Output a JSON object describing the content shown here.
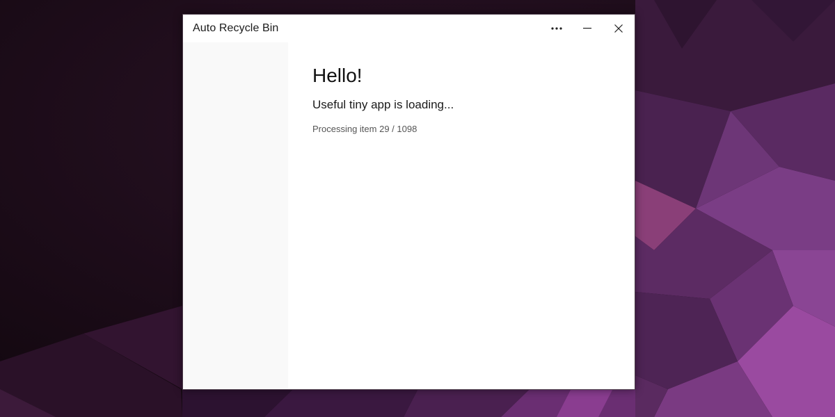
{
  "window": {
    "title": "Auto Recycle Bin",
    "controls": {
      "more_icon": "more-horizontal-icon",
      "minimize_icon": "minimize-icon",
      "close_icon": "close-icon"
    }
  },
  "main": {
    "heading": "Hello!",
    "subtitle": "Useful tiny app is loading...",
    "status": {
      "text": "Processing item 29 / 1098",
      "current": 29,
      "total": 1098
    }
  },
  "colors": {
    "window_background": "#ffffff",
    "sidebar_background": "#f9f9f9",
    "desktop_accent": "#6a2a6e"
  }
}
